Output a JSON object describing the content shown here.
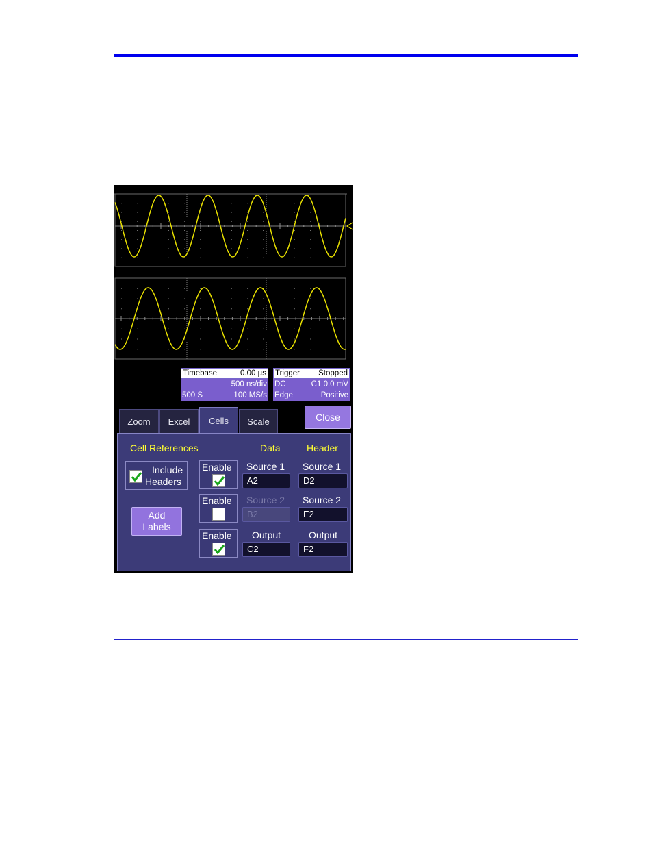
{
  "timebase": {
    "title": "Timebase",
    "delay": "0.00 µs",
    "scale": "500 ns/div",
    "samples": "500 S",
    "rate": "100 MS/s"
  },
  "trigger": {
    "title": "Trigger",
    "state": "Stopped",
    "coupling": "DC",
    "level": "C1  0.0 mV",
    "type": "Edge",
    "slope": "Positive"
  },
  "tabs": [
    "Zoom",
    "Excel",
    "Cells",
    "Scale"
  ],
  "active_tab": "Cells",
  "close_label": "Close",
  "panel": {
    "section_title": "Cell References",
    "col_data": "Data",
    "col_header": "Header",
    "include_headers": {
      "label_line1": "Include",
      "label_line2": "Headers",
      "checked": true
    },
    "add_labels": {
      "line1": "Add",
      "line2": "Labels"
    },
    "rows": [
      {
        "enable_label": "Enable",
        "enabled": true,
        "data_label": "Source 1",
        "data_value": "A2",
        "header_label": "Source 1",
        "header_value": "D2"
      },
      {
        "enable_label": "Enable",
        "enabled": false,
        "data_label": "Source 2",
        "data_value": "B2",
        "header_label": "Source 2",
        "header_value": "E2"
      },
      {
        "enable_label": "Enable",
        "enabled": true,
        "data_label": "Output",
        "data_value": "C2",
        "header_label": "Output",
        "header_value": "F2"
      }
    ]
  },
  "colors": {
    "trace": "#e8e000",
    "panel": "#3c3b78",
    "accent": "#9577e0",
    "label_yellow": "#ffff33"
  }
}
